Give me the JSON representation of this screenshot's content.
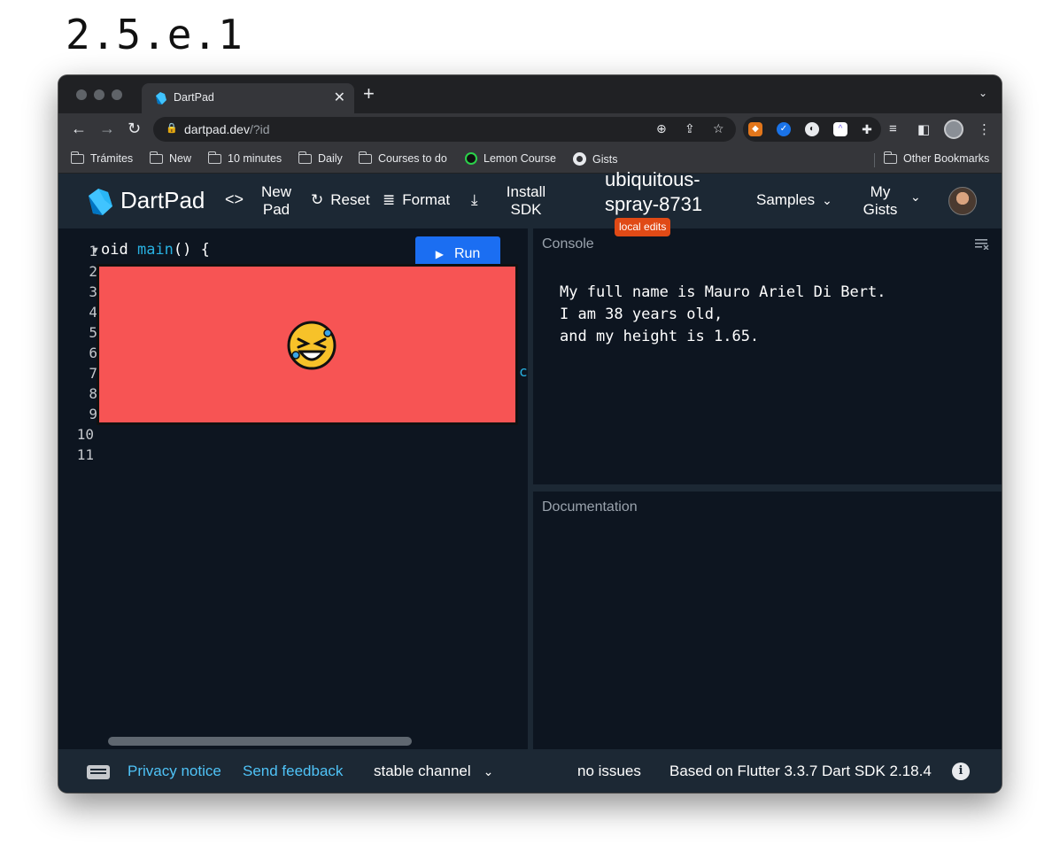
{
  "heading": "2.5.e.1",
  "browser": {
    "tab_title": "DartPad",
    "url_host": "dartpad.dev",
    "url_path": "/?id",
    "bookmarks": [
      {
        "label": "Trámites",
        "icon": "folder-icon"
      },
      {
        "label": "New",
        "icon": "folder-icon"
      },
      {
        "label": "10 minutes",
        "icon": "folder-icon"
      },
      {
        "label": "Daily",
        "icon": "folder-icon"
      },
      {
        "label": "Courses to do",
        "icon": "folder-icon"
      },
      {
        "label": "Lemon Course",
        "icon": "lemon-icon"
      },
      {
        "label": "Gists",
        "icon": "github-icon"
      }
    ],
    "other_bookmarks": "Other Bookmarks"
  },
  "header": {
    "brand": "DartPad",
    "new_pad_line1": "New",
    "new_pad_line2": "Pad",
    "reset": "Reset",
    "format": "Format",
    "install_line1": "Install",
    "install_line2": "SDK",
    "gist_line1": "ubiquitous-",
    "gist_line2": "spray-8731",
    "badge": "local edits",
    "samples": "Samples",
    "my_gists_line1": "My",
    "my_gists_line2": "Gists"
  },
  "editor": {
    "line_numbers": [
      "1",
      "2",
      "3",
      "4",
      "5",
      "6",
      "7",
      "8",
      "9",
      "10",
      "11"
    ],
    "code_line1_prefix": "oid ",
    "code_line1_fn": "main",
    "code_line1_suffix": "() {",
    "run_label": "Run",
    "stray_fragment": "c"
  },
  "console": {
    "label": "Console",
    "output": "My full name is Mauro Ariel Di Bert.\nI am 38 years old,\nand my height is 1.65."
  },
  "documentation": {
    "label": "Documentation"
  },
  "footer": {
    "privacy": "Privacy notice",
    "feedback": "Send feedback",
    "channel": "stable channel",
    "issues": "no issues",
    "version": "Based on Flutter 3.3.7 Dart SDK 2.18.4"
  },
  "colors": {
    "accent": "#1b6ef2",
    "link": "#4fc3f7",
    "redaction": "#f75454",
    "badge": "#e04a16",
    "editor_bg": "#0d1520",
    "header_bg": "#1c2834"
  }
}
